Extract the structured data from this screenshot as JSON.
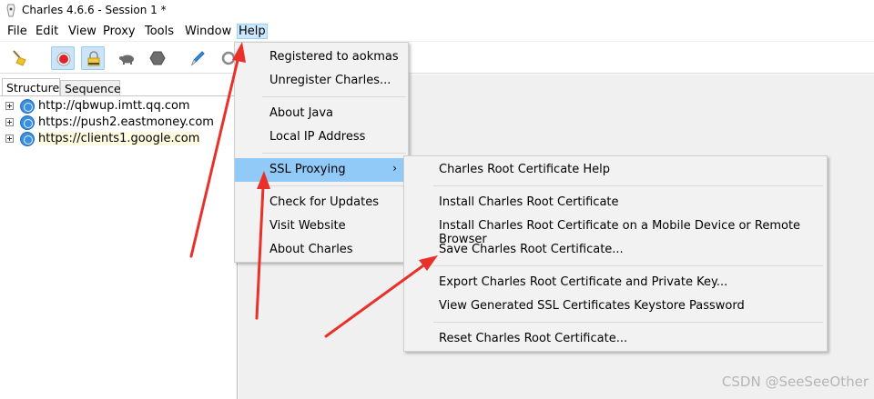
{
  "window": {
    "title": "Charles 4.6.6 - Session 1 *"
  },
  "menubar": {
    "items": [
      "File",
      "Edit",
      "View",
      "Proxy",
      "Tools",
      "Window",
      "Help"
    ],
    "active": "Help"
  },
  "toolbar": {
    "buttons": [
      {
        "name": "broom-icon",
        "pressed": false
      },
      {
        "name": "record-icon",
        "pressed": true
      },
      {
        "name": "ssl-lock-icon",
        "pressed": true
      },
      {
        "name": "throttle-turtle-icon",
        "pressed": false
      },
      {
        "name": "breakpoint-hexagon-icon",
        "pressed": false
      },
      {
        "name": "compose-pen-icon",
        "pressed": false
      },
      {
        "name": "refresh-icon",
        "pressed": false
      }
    ]
  },
  "left_pane": {
    "tabs": [
      "Structure",
      "Sequence"
    ],
    "active_tab": "Structure",
    "hosts": [
      "http://qbwup.imtt.qq.com",
      "https://push2.eastmoney.com",
      "https://clients1.google.com"
    ]
  },
  "help_menu": {
    "items": [
      {
        "label": "Registered to aokmas"
      },
      {
        "label": "Unregister Charles..."
      },
      {
        "label": "About Java"
      },
      {
        "label": "Local IP Address"
      },
      {
        "label": "SSL Proxying",
        "submenu": true,
        "highlighted": true
      },
      {
        "label": "Check for Updates"
      },
      {
        "label": "Visit Website"
      },
      {
        "label": "About Charles"
      }
    ],
    "arrow_glyph": "›"
  },
  "ssl_submenu": {
    "items": [
      {
        "label": "Charles Root Certificate Help"
      },
      {
        "label": "Install Charles Root Certificate"
      },
      {
        "label": "Install Charles Root Certificate on a Mobile Device or Remote Browser"
      },
      {
        "label": "Save Charles Root Certificate..."
      },
      {
        "label": "Export Charles Root Certificate and Private Key..."
      },
      {
        "label": "View Generated SSL Certificates Keystore Password"
      },
      {
        "label": "Reset Charles Root Certificate..."
      }
    ]
  },
  "colors": {
    "menu_highlight": "#91c9f7",
    "annotation_arrow": "#e8312a",
    "record_button": "#e0202a"
  },
  "watermark": "CSDN @SeeSeeOther"
}
